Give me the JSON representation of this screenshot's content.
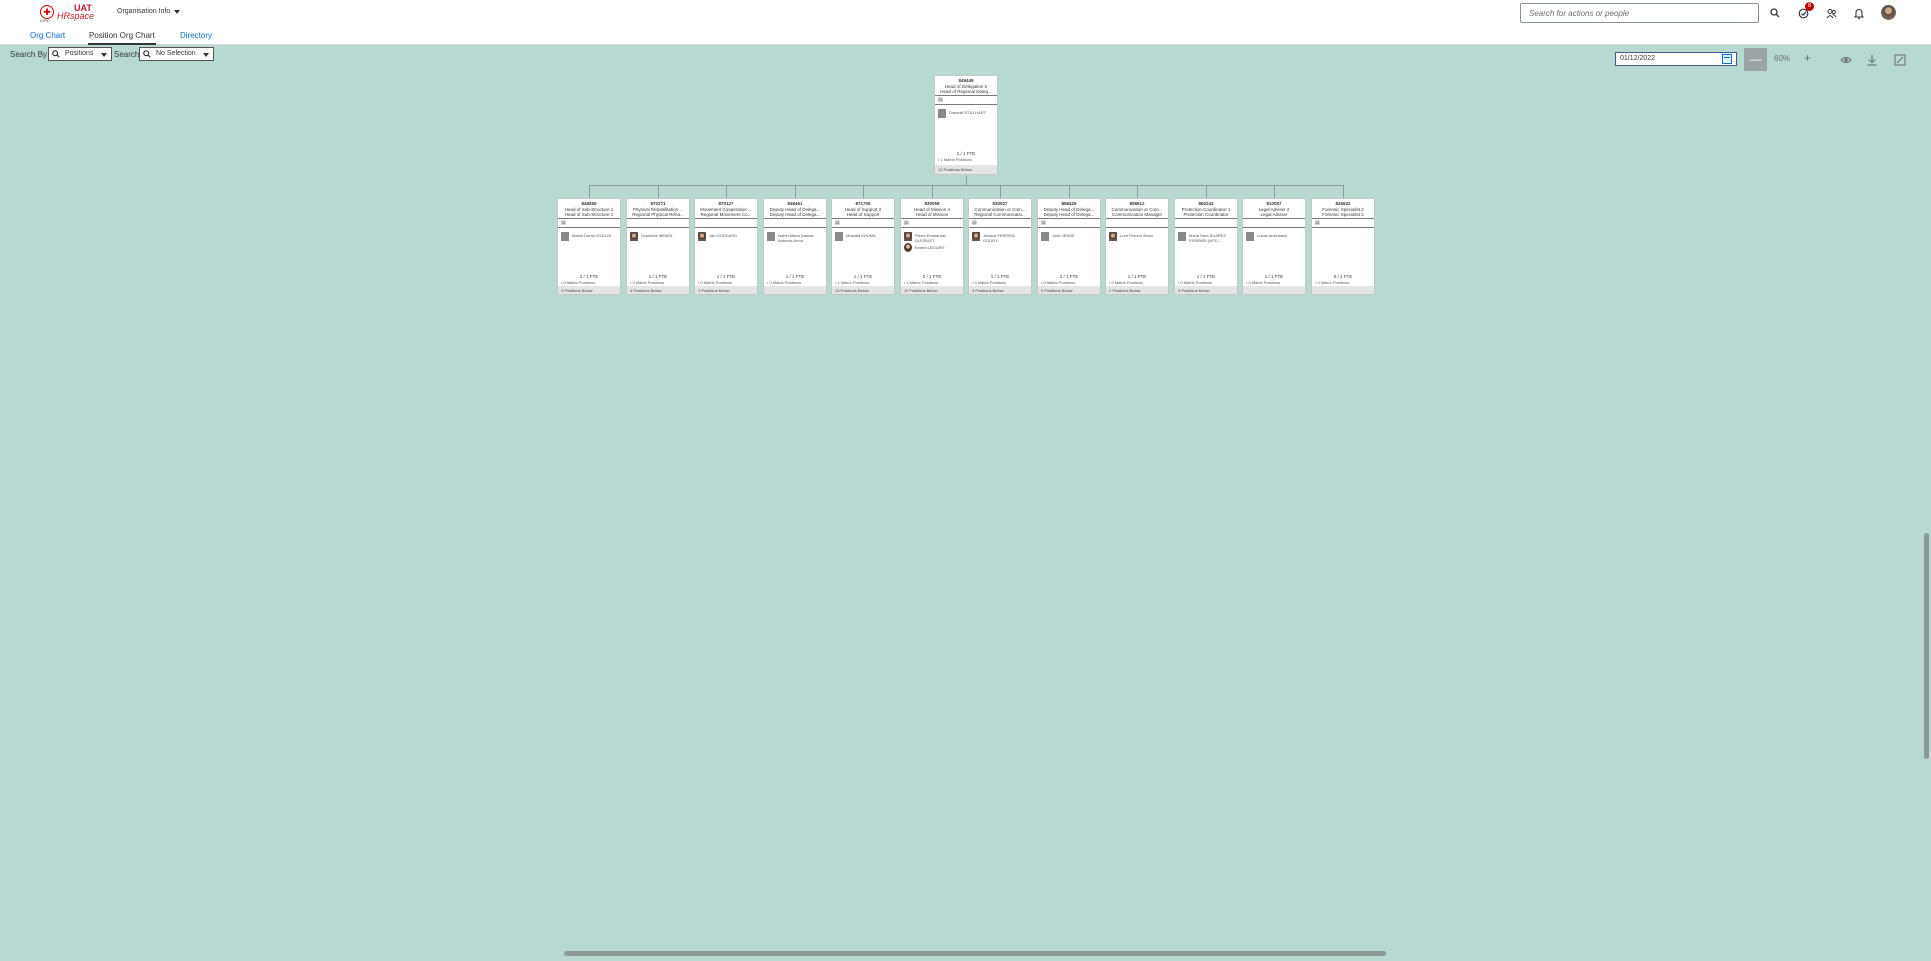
{
  "shell": {
    "logo_emblem": "✚",
    "logo_sub": "ICRC",
    "logo_uat": "UAT",
    "logo_hr": "HRspace",
    "app_menu": "Organisation Info",
    "search_placeholder": "Search for actions or people",
    "notification_badge": "8",
    "icons": [
      "search-icon",
      "tasks-icon",
      "people-icon",
      "bell-icon",
      "user-avatar"
    ]
  },
  "tabs": [
    {
      "label": "Org Chart",
      "active": false
    },
    {
      "label": "Position Org Chart",
      "active": true
    },
    {
      "label": "Directory",
      "active": false
    }
  ],
  "filters": {
    "search_by_label": "Search By",
    "search_by_value": "Positions",
    "search_label": "Search",
    "search_value": "No Selection"
  },
  "toolbar": {
    "date": "01/12/2022",
    "zoom_minus": "—",
    "zoom_level": "60%",
    "zoom_plus": "+"
  },
  "root": {
    "id": "849449",
    "title1": "Head of Delegation 2",
    "title2": "Head of Regional Deleg...",
    "employee": "Dominik STILLHART",
    "fte": "1 / 1 FTE",
    "vacant": "• 1 Matrix Positions",
    "below": "12 Positions Below"
  },
  "children": [
    {
      "id": "848050",
      "title1": "Head of Sub-Structure 1",
      "title2": "Head of Sub-Structure 1",
      "employee": "Martin Daniel DOLLIN",
      "fte": "1 / 1 FTE",
      "vacant": "• 0 Matrix Positions",
      "below": "3 Positions Below",
      "doc": true,
      "photo": "grey"
    },
    {
      "id": "870271",
      "title1": "Physical Rehabilitation ...",
      "title2": "Regional Physical Reha...",
      "employee": "Sophiane MEMIN",
      "fte": "1 / 1 FTE",
      "vacant": "• 2 Matrix Positions",
      "below": "4 Positions Below",
      "doc": false,
      "photo": "face"
    },
    {
      "id": "870127",
      "title1": "Movement Cooperation ...",
      "title2": "Regional Movement Co...",
      "employee": "Jan GODDARD",
      "fte": "1 / 1 FTE",
      "vacant": "• 0 Matrix Positions",
      "below": "2 Positions Below",
      "doc": false,
      "photo": "face"
    },
    {
      "id": "849461",
      "title1": "Deputy Head of Delega...",
      "title2": "Deputy Head of Delega...",
      "employee": "Isabel Maria Dantas Antunes Amor",
      "fte": "1 / 1 FTE",
      "vacant": "• 0 Matrix Positions",
      "below": "",
      "doc": false,
      "photo": "grey"
    },
    {
      "id": "871705",
      "title1": "Head of Support 2",
      "title2": "Head of Support",
      "employee": "Mustafa KHUMA",
      "fte": "1 / 1 FTE",
      "vacant": "• 1 Matrix Positions",
      "below": "13 Positions Below",
      "doc": true,
      "photo": "grey"
    },
    {
      "id": "830058",
      "title1": "Head of Mission 4",
      "title2": "Head of Mission",
      "employee": "Pierre Emmanuel DUCRUET",
      "employee2": "Emma LEGUIRT",
      "fte": "2 / 1 FTE",
      "vacant": "• 2 Matrix Positions",
      "below": "11 Positions Below",
      "doc": true,
      "photo": "face",
      "photo2": true
    },
    {
      "id": "830027",
      "title1": "Communication or Com...",
      "title2": "Regional Communicatio...",
      "employee": "Jessica FEREIRA GODOY",
      "fte": "1 / 1 FTE",
      "vacant": "• 0 Matrix Positions",
      "below": "3 Positions Below",
      "doc": true,
      "photo": "face"
    },
    {
      "id": "858429",
      "title1": "Deputy Head of Delega...",
      "title2": "Deputy Head of Delega...",
      "employee": "Joan JENSE",
      "fte": "1 / 1 FTE",
      "vacant": "• 0 Matrix Positions",
      "below": "5 Positions Below",
      "doc": true,
      "photo": "grey"
    },
    {
      "id": "808612",
      "title1": "Communication or Com...",
      "title2": "Communication Manager",
      "employee": "Lore Ferrero Bratu",
      "fte": "1 / 1 FTE",
      "vacant": "• 0 Matrix Positions",
      "below": "2 Positions Below",
      "doc": false,
      "photo": "face"
    },
    {
      "id": "860243",
      "title1": "Protection Coordinator 1",
      "title2": "Protection Coordinator",
      "employee": "Maria Sara SUAREZ FERRARI (WTI)...",
      "fte": "1 / 1 FTE",
      "vacant": "• 0 Matrix Positions",
      "below": "0 Positions Below",
      "doc": false,
      "photo": "grey"
    },
    {
      "id": "810057",
      "title1": "Legal Adviser 2",
      "title2": "Legal Adviser",
      "employee": "Lukas Anzinbach",
      "fte": "1 / 1 FTE",
      "vacant": "• 0 Matrix Positions",
      "below": "",
      "doc": false,
      "photo": "grey"
    },
    {
      "id": "826632",
      "title1": "Forensic Specialist 2",
      "title2": "Forensic Specialist 2",
      "employee": "",
      "fte": "0 / 1 FTE",
      "vacant": "• 0 Matrix Positions",
      "below": "",
      "doc": true,
      "photo": "none"
    }
  ]
}
